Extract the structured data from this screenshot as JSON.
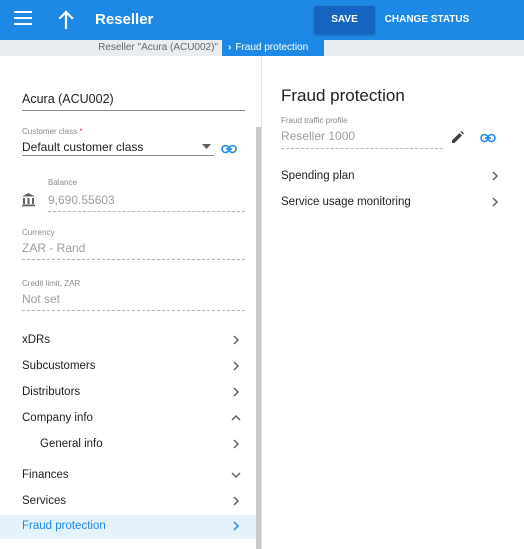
{
  "header": {
    "title": "Reseller",
    "save_label": "SAVE",
    "change_status_label": "CHANGE STATUS",
    "accent_color": "#1e88e5",
    "save_color": "#1565c0"
  },
  "breadcrumb": {
    "parent": "Reseller \"Acura (ACU002)\"",
    "current": "Fraud protection"
  },
  "left": {
    "name_value": "Acura (ACU002)",
    "customer_class": {
      "label": "Customer class",
      "required_mark": "*",
      "value": "Default customer class"
    },
    "balance": {
      "label": "Balance",
      "value": "9,690.55603"
    },
    "currency": {
      "label": "Currency",
      "value": "ZAR - Rand"
    },
    "credit_limit": {
      "label": "Credit limit, ZAR",
      "placeholder": "Not set"
    },
    "nav": [
      {
        "label": "xDRs",
        "chevron": "chevron-right"
      },
      {
        "label": "Subcustomers",
        "chevron": "chevron-right"
      },
      {
        "label": "Distributors",
        "chevron": "chevron-right"
      },
      {
        "label": "Company info",
        "chevron": "chevron-up"
      },
      {
        "label": "General info",
        "chevron": "chevron-right"
      },
      {
        "label": "Finances",
        "chevron": "chevron-down"
      },
      {
        "label": "Services",
        "chevron": "chevron-right"
      },
      {
        "label": "Fraud protection",
        "chevron": "chevron-right"
      }
    ]
  },
  "right": {
    "title": "Fraud protection",
    "fraud_profile": {
      "label": "Fraud traffic profile",
      "value": "Reseller 1000"
    },
    "rows": [
      {
        "label": "Spending plan"
      },
      {
        "label": "Service usage monitoring"
      }
    ]
  }
}
